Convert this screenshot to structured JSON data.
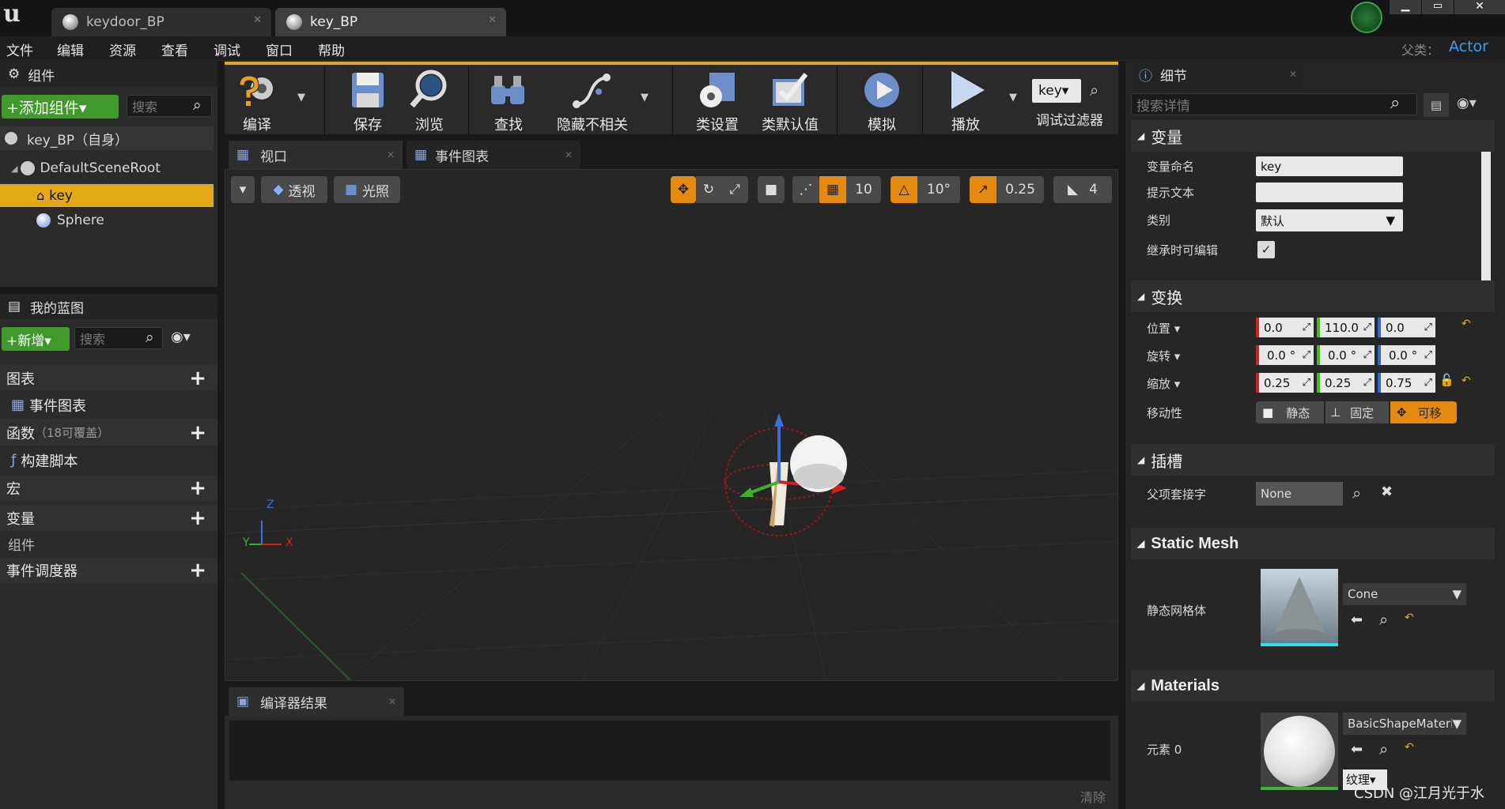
{
  "app": {
    "logo": "u"
  },
  "tabs": [
    {
      "label": "keydoor_BP",
      "active": false
    },
    {
      "label": "key_BP",
      "active": true
    }
  ],
  "menu": [
    "文件",
    "编辑",
    "资源",
    "查看",
    "调试",
    "窗口",
    "帮助"
  ],
  "parent": {
    "label": "父类：",
    "value": "Actor"
  },
  "components": {
    "title": "组件",
    "add_button": "+添加组件▾",
    "search_placeholder": "搜索",
    "self": "key_BP（自身）",
    "tree": [
      {
        "label": "DefaultSceneRoot"
      },
      {
        "label": "key",
        "selected": true
      },
      {
        "label": "Sphere"
      }
    ]
  },
  "myblueprint": {
    "title": "我的蓝图",
    "new_button": "+新增▾",
    "search_placeholder": "搜索",
    "sections": [
      {
        "label": "图表",
        "plus": true
      },
      {
        "label": "事件图表",
        "child": true
      },
      {
        "label": "函数",
        "extra": "（18可覆盖）",
        "plus": true
      },
      {
        "label": "构建脚本",
        "child": true
      },
      {
        "label": "宏",
        "plus": true
      },
      {
        "label": "变量",
        "plus": true
      },
      {
        "label": "组件",
        "child": true
      },
      {
        "label": "事件调度器",
        "plus": true
      }
    ]
  },
  "toolbar": [
    {
      "label": "编译",
      "icon": "compile-icon"
    },
    {
      "label": "保存",
      "icon": "save-icon"
    },
    {
      "label": "浏览",
      "icon": "browse-icon"
    },
    {
      "label": "查找",
      "icon": "find-icon"
    },
    {
      "label": "隐藏不相关",
      "icon": "hide-unrelated-icon"
    },
    {
      "label": "类设置",
      "icon": "class-settings-icon"
    },
    {
      "label": "类默认值",
      "icon": "class-defaults-icon"
    },
    {
      "label": "模拟",
      "icon": "simulate-icon"
    },
    {
      "label": "播放",
      "icon": "play-icon"
    }
  ],
  "debug_filter": {
    "value": "key▾",
    "label": "调试过滤器"
  },
  "viewport": {
    "tabs": [
      "视口",
      "事件图表"
    ],
    "perspective": "透视",
    "lighting": "光照",
    "grid": "10",
    "angle": "10°",
    "scale": "0.25",
    "camera_speed": "4",
    "axes": {
      "z": "Z",
      "y": "Y",
      "x": "X"
    }
  },
  "compiler": {
    "title": "编译器结果",
    "clear": "清除"
  },
  "details": {
    "title": "细节",
    "search_placeholder": "搜索详情",
    "variable": {
      "header": "变量",
      "name_label": "变量命名",
      "name_value": "key",
      "tooltip_label": "提示文本",
      "tooltip_value": "",
      "category_label": "类别",
      "category_value": "默认",
      "editable_label": "继承时可编辑",
      "editable": true
    },
    "transform": {
      "header": "变换",
      "location_label": "位置",
      "location": [
        "0.0",
        "110.0",
        "0.0"
      ],
      "rotation_label": "旋转",
      "rotation": [
        "0.0 °",
        "0.0 °",
        "0.0 °"
      ],
      "scale_label": "缩放",
      "scale": [
        "0.25",
        "0.25",
        "0.75"
      ],
      "mobility_label": "移动性",
      "mobility": [
        "静态",
        "固定",
        "可移"
      ]
    },
    "sockets": {
      "header": "插槽",
      "parent_socket_label": "父项套接字",
      "parent_socket_value": "None"
    },
    "static_mesh": {
      "header": "Static Mesh",
      "label": "静态网格体",
      "value": "Cone"
    },
    "materials": {
      "header": "Materials",
      "label": "元素 0",
      "value": "BasicShapeMateria",
      "texture": "纹理▾"
    }
  },
  "watermark": "CSDN @江月光于水",
  "colors": {
    "accent": "#e4a916",
    "green": "#3f9a2b",
    "orange": "#e48a10"
  }
}
